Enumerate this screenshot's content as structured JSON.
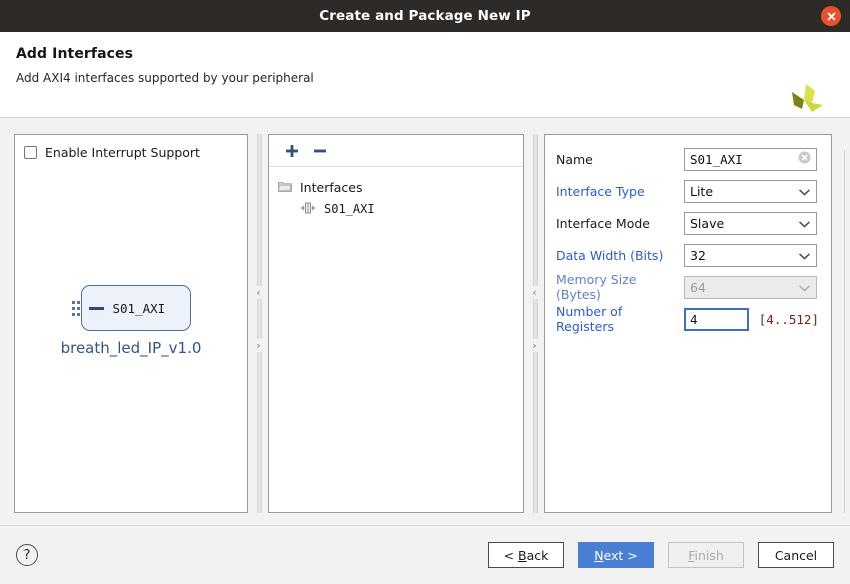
{
  "titlebar": {
    "title": "Create and Package New IP",
    "close_icon": "close-icon"
  },
  "header": {
    "title": "Add Interfaces",
    "subtitle": "Add AXI4 interfaces supported by your peripheral",
    "logo_icon": "vivado-logo-icon"
  },
  "left_panel": {
    "interrupt_checkbox": {
      "label": "Enable Interrupt Support",
      "checked": false
    },
    "diagram": {
      "port_label": "S01_AXI",
      "module_name": "breath_led_IP_v1.0"
    }
  },
  "middle_panel": {
    "toolbar": {
      "add_label": "+",
      "remove_label": "−"
    },
    "tree": [
      {
        "label": "Interfaces",
        "icon": "folder-icon",
        "level": 0
      },
      {
        "label": "S01_AXI",
        "icon": "bus-interface-icon",
        "level": 1
      }
    ]
  },
  "right_panel": {
    "fields": [
      {
        "label": "Name",
        "label_color": "black",
        "type": "text",
        "value": "S01_AXI",
        "clear_icon": "clear-icon",
        "disabled": false,
        "focused": false
      },
      {
        "label": "Interface Type",
        "label_color": "blue",
        "type": "select",
        "value": "Lite",
        "disabled": false
      },
      {
        "label": "Interface Mode",
        "label_color": "black",
        "type": "select",
        "value": "Slave",
        "disabled": false
      },
      {
        "label": "Data Width (Bits)",
        "label_color": "blue",
        "type": "select",
        "value": "32",
        "disabled": false
      },
      {
        "label": "Memory Size (Bytes)",
        "label_color": "blue-dim",
        "type": "select",
        "value": "64",
        "disabled": true
      },
      {
        "label": "Number of Registers",
        "label_color": "blue",
        "type": "text",
        "value": "4",
        "hint": "[4..512]",
        "disabled": false,
        "focused": true
      }
    ]
  },
  "splitters": {
    "collapse_left_icon": "chevron-left-icon",
    "collapse_right_icon": "chevron-right-icon",
    "collapse_left_glyph": "‹",
    "collapse_right_glyph": "›"
  },
  "footer": {
    "help_label": "?",
    "buttons": [
      {
        "pre": "< ",
        "mnemonic": "B",
        "post": "ack",
        "style": "normal",
        "name": "back-button"
      },
      {
        "pre": "",
        "mnemonic": "N",
        "post": "ext >",
        "style": "primary",
        "name": "next-button"
      },
      {
        "pre": "",
        "mnemonic": "F",
        "post": "inish",
        "style": "disabled",
        "name": "finish-button"
      },
      {
        "pre": "Cancel",
        "mnemonic": "",
        "post": "",
        "style": "normal",
        "name": "cancel-button"
      }
    ]
  },
  "colors": {
    "titlebar_bg": "#2e2a28",
    "close_btn": "#e8512b",
    "accent_blue": "#4a7fd4",
    "label_blue": "#2a5bd7",
    "hint_red": "#7a2018",
    "block_border": "#4a6ea9",
    "block_fill": "#edf2fa",
    "module_name": "#33538f",
    "logo_green_light": "#dbe14a",
    "logo_green_mid": "#c2cc2a",
    "logo_green_dark": "#7d8411"
  }
}
